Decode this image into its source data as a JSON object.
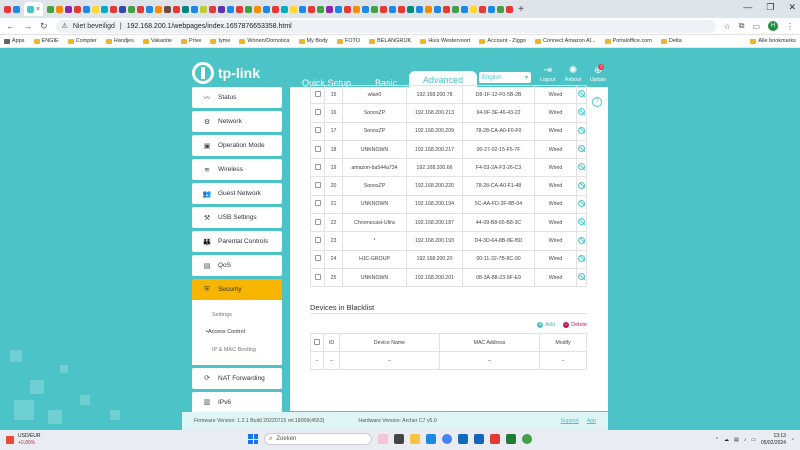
{
  "browser": {
    "active_tab_close": "×",
    "new_tab": "+",
    "win_controls": [
      "—",
      "❐",
      "✕"
    ],
    "security_label": "Niet beveiligd",
    "url": "192.168.200.1/webpages/index.1657876653358.html",
    "bookmarks": [
      "Apps",
      "ENGIE",
      "Compter",
      "Handjes",
      "Vakantie",
      "Prive",
      "Iyme",
      "Wonen/Domotica",
      "My Body",
      "FOTO",
      "BELANGRIJK",
      "Huis Westervoort",
      "Account - Ziggo",
      "Connect Amazon Al...",
      "Portaloffice.com",
      "Delta"
    ],
    "bookmarks_all": "Alle bookmarks",
    "avatar_letter": "H"
  },
  "header": {
    "logo_text": "tp-link",
    "tabs": [
      "Quick Setup",
      "Basic",
      "Advanced"
    ],
    "language": "English",
    "logout": "Logout",
    "reboot": "Reboot",
    "update": "Update",
    "update_badge": "1"
  },
  "sidebar": {
    "items": [
      {
        "label": "Status",
        "icon": "〰"
      },
      {
        "label": "Network",
        "icon": "⚙"
      },
      {
        "label": "Operation Mode",
        "icon": "▣"
      },
      {
        "label": "Wireless",
        "icon": "≋"
      },
      {
        "label": "Guest Network",
        "icon": "👥"
      },
      {
        "label": "USB Settings",
        "icon": "⚒"
      },
      {
        "label": "Parental Controls",
        "icon": "👪"
      },
      {
        "label": "QoS",
        "icon": "▤"
      },
      {
        "label": "Security",
        "icon": "⛨"
      },
      {
        "label": "NAT Forwarding",
        "icon": "⟳"
      },
      {
        "label": "IPv6",
        "icon": "▥"
      }
    ],
    "security_sub": [
      "Settings",
      "Access Control",
      "IP & MAC Binding"
    ]
  },
  "devices": [
    {
      "id": "15",
      "name": "wlan0",
      "ip": "192.168.200.78",
      "mac": "D8-1F-12-F0-5B-2B",
      "type": "Wired"
    },
    {
      "id": "16",
      "name": "SonosZP",
      "ip": "192.168.200.213",
      "mac": "94-9F-3E-46-43-22",
      "type": "Wired"
    },
    {
      "id": "17",
      "name": "SonosZP",
      "ip": "192.168.200.209",
      "mac": "78-28-CA-A0-F0-F0",
      "type": "Wired"
    },
    {
      "id": "18",
      "name": "UNKNOWN",
      "ip": "192.168.200.217",
      "mac": "00-27-02-15-F5-7F",
      "type": "Wired"
    },
    {
      "id": "19",
      "name": "amazon-ba544a734",
      "ip": "192.168.200.66",
      "mac": "F4-03-2A-F3-26-C3",
      "type": "Wired"
    },
    {
      "id": "20",
      "name": "SonosZP",
      "ip": "192.168.200.220",
      "mac": "78-28-CA-A0-F1-48",
      "type": "Wired"
    },
    {
      "id": "21",
      "name": "UNKNOWN",
      "ip": "192.168.200.194",
      "mac": "5C-AA-FD-3F-8B-04",
      "type": "Wired"
    },
    {
      "id": "22",
      "name": "Chromecast-Ultra",
      "ip": "192.168.200.187",
      "mac": "44-09-B8-65-B8-3C",
      "type": "Wired"
    },
    {
      "id": "23",
      "name": "*",
      "ip": "192.168.200.193",
      "mac": "D4-3D-64-8B-8E-BD",
      "type": "Wired"
    },
    {
      "id": "24",
      "name": "HJC-GROUP",
      "ip": "192.168.200.20",
      "mac": "00-11-32-7B-8C-90",
      "type": "Wired"
    },
    {
      "id": "25",
      "name": "UNKNOWN",
      "ip": "192.168.200.201",
      "mac": "08-3A-88-23-9F-E9",
      "type": "Wired"
    }
  ],
  "blacklist": {
    "title": "Devices in Blacklist",
    "add": "Add",
    "delete": "Delete",
    "headers": [
      "ID",
      "Device Name",
      "MAC Address",
      "Modify"
    ],
    "empty_row": [
      "--",
      "--",
      "--",
      "--",
      "--"
    ]
  },
  "footer": {
    "firmware": "Firmware Version: 1.2.1 Build 20220715 rel.18009(4553)",
    "hardware": "Hardware Version: Archer C7 v5.0",
    "support": "Support",
    "app": "App"
  },
  "taskbar": {
    "ticker": "USD/EUR",
    "change": "+0,80%",
    "search": "Zoeken",
    "time": "13:13",
    "date": "05/02/2024"
  },
  "colors": {
    "brand": "#4cc3c7",
    "active": "#f7b500",
    "delete": "#c2185b"
  }
}
